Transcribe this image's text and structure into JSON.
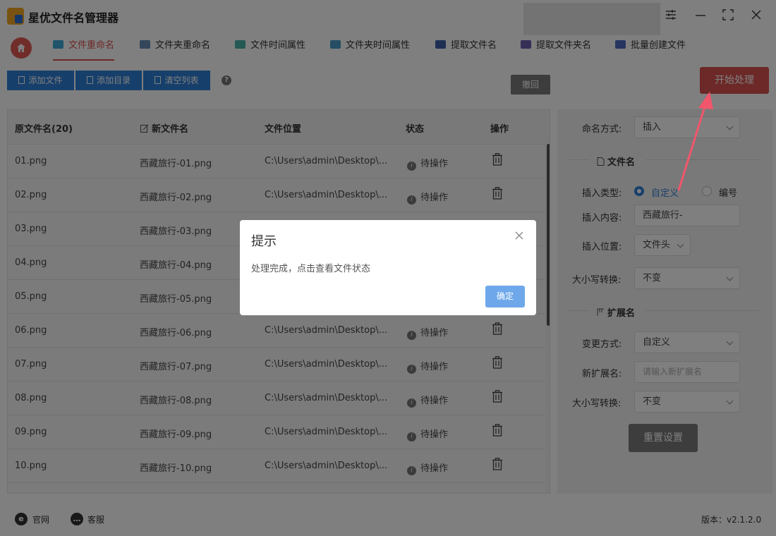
{
  "app": {
    "title": "星优文件名管理器"
  },
  "nav": {
    "tabs": [
      {
        "label": "文件重命名",
        "active": true,
        "icon": "rename-icon"
      },
      {
        "label": "文件夹重命名",
        "active": false,
        "icon": "folder-rename-icon"
      },
      {
        "label": "文件时间属性",
        "active": false,
        "icon": "file-time-icon"
      },
      {
        "label": "文件夹时间属性",
        "active": false,
        "icon": "folder-time-icon"
      },
      {
        "label": "提取文件名",
        "active": false,
        "icon": "extract-filename-icon"
      },
      {
        "label": "提取文件夹名",
        "active": false,
        "icon": "extract-foldername-icon"
      },
      {
        "label": "批量创建文件",
        "active": false,
        "icon": "batch-create-icon"
      }
    ]
  },
  "toolbar": {
    "add_file": "添加文件",
    "add_dir": "添加目录",
    "clear_list": "清空列表",
    "help": "?",
    "undo": "撤回",
    "start": "开始处理"
  },
  "table": {
    "headers": {
      "original": "原文件名(20)",
      "new": "新文件名",
      "location": "文件位置",
      "status": "状态",
      "action": "操作"
    },
    "rows": [
      {
        "original": "01.png",
        "new": "西藏旅行-01.png",
        "location": "C:\\Users\\admin\\Desktop\\...",
        "status": "待操作"
      },
      {
        "original": "02.png",
        "new": "西藏旅行-02.png",
        "location": "C:\\Users\\admin\\Desktop\\...",
        "status": "待操作"
      },
      {
        "original": "03.png",
        "new": "西藏旅行-03.png",
        "location": "",
        "status": ""
      },
      {
        "original": "04.png",
        "new": "西藏旅行-04.png",
        "location": "",
        "status": ""
      },
      {
        "original": "05.png",
        "new": "西藏旅行-05.png",
        "location": "",
        "status": ""
      },
      {
        "original": "06.png",
        "new": "西藏旅行-06.png",
        "location": "C:\\Users\\admin\\Desktop\\...",
        "status": "待操作"
      },
      {
        "original": "07.png",
        "new": "西藏旅行-07.png",
        "location": "C:\\Users\\admin\\Desktop\\...",
        "status": "待操作"
      },
      {
        "original": "08.png",
        "new": "西藏旅行-08.png",
        "location": "C:\\Users\\admin\\Desktop\\...",
        "status": "待操作"
      },
      {
        "original": "09.png",
        "new": "西藏旅行-09.png",
        "location": "C:\\Users\\admin\\Desktop\\...",
        "status": "待操作"
      },
      {
        "original": "10.png",
        "new": "西藏旅行-10.png",
        "location": "C:\\Users\\admin\\Desktop\\...",
        "status": "待操作"
      }
    ]
  },
  "panel": {
    "naming_method_label": "命名方式:",
    "naming_method_value": "插入",
    "filename_section": "文件名",
    "insert_type_label": "插入类型:",
    "insert_type_custom": "自定义",
    "insert_type_number": "编号",
    "insert_content_label": "插入内容:",
    "insert_content_value": "西藏旅行-",
    "insert_position_label": "插入位置:",
    "insert_position_value": "文件头",
    "case_label": "大小写转换:",
    "case_value": "不变",
    "ext_section": "扩展名",
    "change_method_label": "变更方式:",
    "change_method_value": "自定义",
    "new_ext_label": "新扩展名:",
    "new_ext_placeholder": "请输入新扩展名",
    "ext_case_label": "大小写转换:",
    "ext_case_value": "不变",
    "reset": "重置设置"
  },
  "footer": {
    "website": "官网",
    "support": "客服",
    "version": "版本：v2.1.2.0"
  },
  "modal": {
    "title": "提示",
    "message": "处理完成，点击查看文件状态",
    "ok": "确定"
  },
  "colors": {
    "accent_red": "#d9534f",
    "accent_blue": "#2f7fd6",
    "annotation_arrow": "#f2566b"
  }
}
